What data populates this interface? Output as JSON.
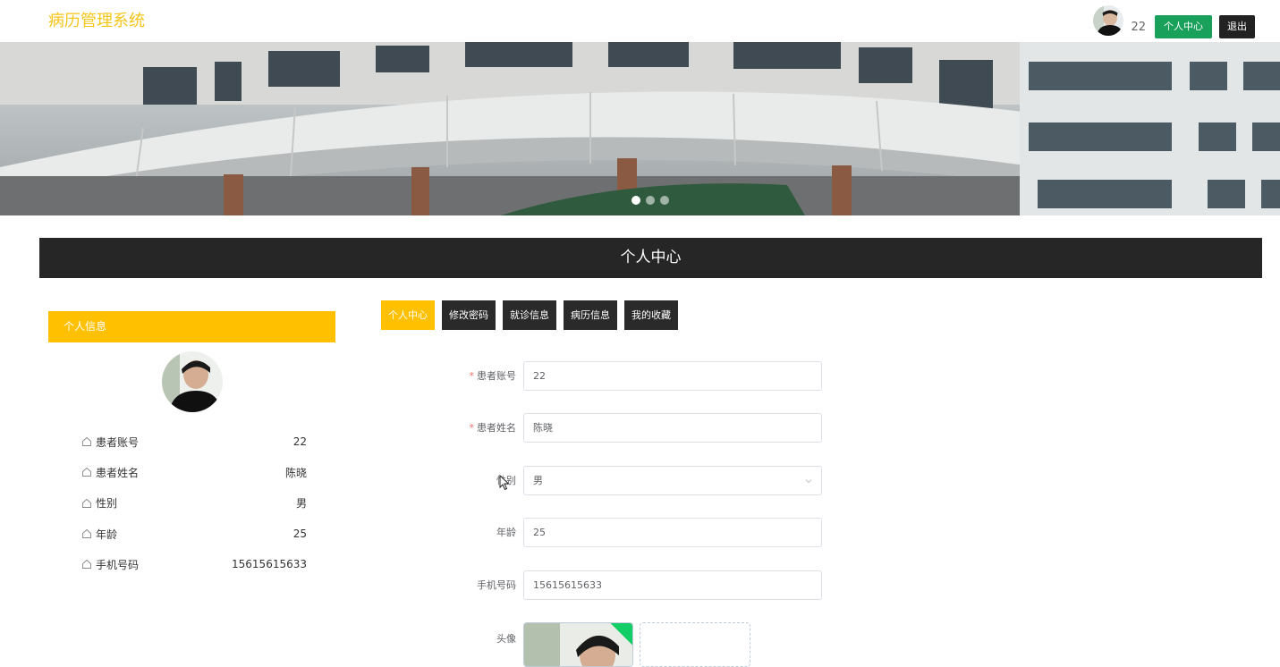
{
  "header": {
    "brand": "病历管理系统",
    "username": "22",
    "profile_button": "个人中心",
    "logout_button": "退出",
    "colors": {
      "brand": "#f5c518",
      "profile_button": "#19a05a",
      "logout_button": "#222222"
    }
  },
  "banner": {
    "active_slide": 1,
    "slide_count": 3
  },
  "section": {
    "title": "个人中心"
  },
  "sidebar": {
    "heading": "个人信息",
    "items": [
      {
        "label": "患者账号",
        "value": "22"
      },
      {
        "label": "患者姓名",
        "value": "陈晓"
      },
      {
        "label": "性别",
        "value": "男"
      },
      {
        "label": "年龄",
        "value": "25"
      },
      {
        "label": "手机号码",
        "value": "15615615633"
      }
    ]
  },
  "tabs": [
    {
      "label": "个人中心",
      "active": true
    },
    {
      "label": "修改密码",
      "active": false
    },
    {
      "label": "就诊信息",
      "active": false
    },
    {
      "label": "病历信息",
      "active": false
    },
    {
      "label": "我的收藏",
      "active": false
    }
  ],
  "form": {
    "account": {
      "label": "患者账号",
      "required": "*",
      "value": "22"
    },
    "name": {
      "label": "患者姓名",
      "required": "*",
      "value": "陈晓"
    },
    "gender": {
      "label": "性别",
      "value": "男"
    },
    "age": {
      "label": "年龄",
      "value": "25"
    },
    "phone": {
      "label": "手机号码",
      "value": "15615615633"
    },
    "avatar": {
      "label": "头像"
    }
  },
  "accent_color": "#ffc000"
}
